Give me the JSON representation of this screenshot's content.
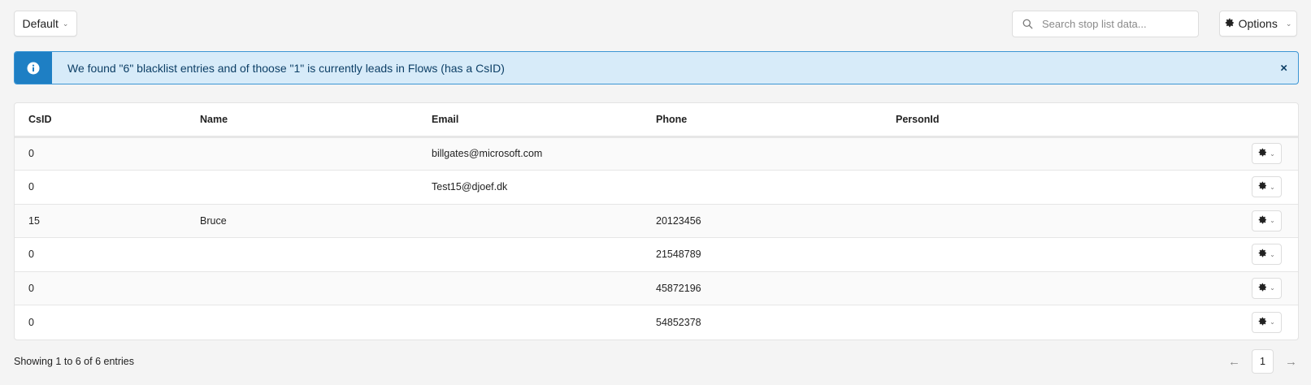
{
  "toolbar": {
    "view_label": "Default",
    "options_label": "Options",
    "search": {
      "placeholder": "Search stop list data...",
      "value": ""
    }
  },
  "alert": {
    "message": "We found \"6\" blacklist entries and of thoose \"1\" is currently leads in Flows (has a CsID)",
    "close_label": "×",
    "color_bg": "#d7ebf9",
    "color_accent": "#1e7fc4"
  },
  "table": {
    "columns": [
      "CsID",
      "Name",
      "Email",
      "Phone",
      "PersonId",
      ""
    ],
    "rows": [
      [
        "0",
        "",
        "billgates@microsoft.com",
        "",
        ""
      ],
      [
        "0",
        "",
        "Test15@djoef.dk",
        "",
        ""
      ],
      [
        "15",
        "Bruce",
        "",
        "20123456",
        ""
      ],
      [
        "0",
        "",
        "",
        "21548789",
        ""
      ],
      [
        "0",
        "",
        "",
        "45872196",
        ""
      ],
      [
        "0",
        "",
        "",
        "54852378",
        ""
      ]
    ]
  },
  "footer": {
    "info": "Showing 1 to 6 of 6 entries",
    "prev": "←",
    "page": "1",
    "next": "→"
  },
  "icons": {
    "search": "search-icon",
    "gear": "gear-icon",
    "info": "info-icon",
    "close": "close-icon",
    "chevron": "chevron-down-icon"
  }
}
